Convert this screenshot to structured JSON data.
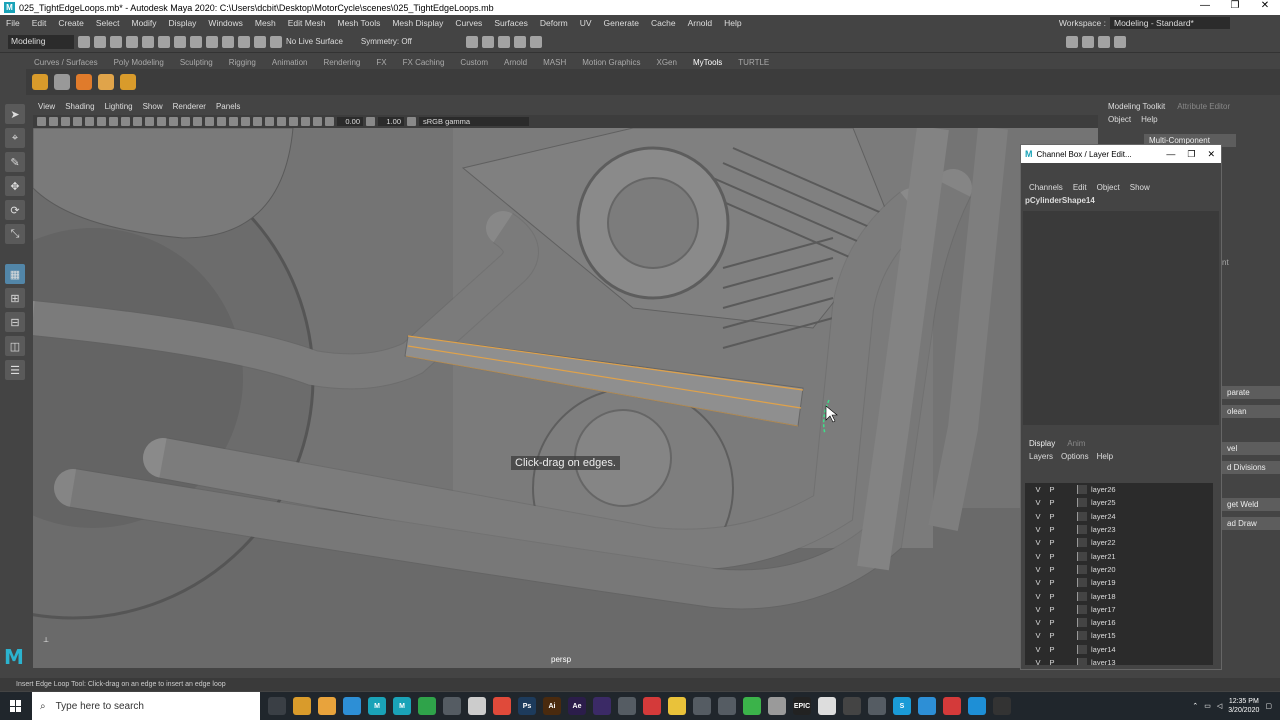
{
  "window": {
    "title": "025_TightEdgeLoops.mb* - Autodesk Maya 2020: C:\\Users\\dcbit\\Desktop\\MotorCycle\\scenes\\025_TightEdgeLoops.mb",
    "minimize": "—",
    "maximize": "❐",
    "close": "✕"
  },
  "menubar": {
    "items": [
      "File",
      "Edit",
      "Create",
      "Select",
      "Modify",
      "Display",
      "Windows",
      "Mesh",
      "Edit Mesh",
      "Mesh Tools",
      "Mesh Display",
      "Curves",
      "Surfaces",
      "Deform",
      "UV",
      "Generate",
      "Cache",
      "Arnold",
      "Help"
    ],
    "workspace_label": "Workspace :",
    "workspace_value": "Modeling - Standard*"
  },
  "statusline": {
    "mode": "Modeling",
    "live_surface": "No Live Surface",
    "symmetry": "Symmetry: Off"
  },
  "shelf": {
    "tabs": [
      "Curves / Surfaces",
      "Poly Modeling",
      "Sculpting",
      "Rigging",
      "Animation",
      "Rendering",
      "FX",
      "FX Caching",
      "Custom",
      "Arnold",
      "MASH",
      "Motion Graphics",
      "XGen",
      "MyTools",
      "TURTLE"
    ],
    "active_tab": "MyTools"
  },
  "panel": {
    "menus": [
      "View",
      "Shading",
      "Lighting",
      "Show",
      "Renderer",
      "Panels"
    ],
    "exposure": "0.00",
    "gamma": "1.00",
    "color_management": "sRGB gamma",
    "camera": "persp",
    "hint": "Click-drag on edges."
  },
  "modeling_toolkit": {
    "tab_active": "Modeling Toolkit",
    "tab_inactive": "Attribute Editor",
    "menus": [
      "Object",
      "Help"
    ],
    "multi_component": "Multi-Component",
    "buttons": [
      "parate",
      "olean",
      "vel",
      "d Divisions",
      "get Weld",
      "ad Draw"
    ],
    "side_text": "nt"
  },
  "channel_box": {
    "title": "Channel Box / Layer Edit...",
    "menus": [
      "Channels",
      "Edit",
      "Object",
      "Show"
    ],
    "shape": "pCylinderShape14",
    "layer_tabs": [
      "Display",
      "Anim"
    ],
    "layer_menus": [
      "Layers",
      "Options",
      "Help"
    ],
    "layers": [
      {
        "v": "V",
        "p": "P",
        "name": "layer26"
      },
      {
        "v": "V",
        "p": "P",
        "name": "layer25"
      },
      {
        "v": "V",
        "p": "P",
        "name": "layer24"
      },
      {
        "v": "V",
        "p": "P",
        "name": "layer23"
      },
      {
        "v": "V",
        "p": "P",
        "name": "layer22"
      },
      {
        "v": "V",
        "p": "P",
        "name": "layer21"
      },
      {
        "v": "V",
        "p": "P",
        "name": "layer20"
      },
      {
        "v": "V",
        "p": "P",
        "name": "layer19"
      },
      {
        "v": "V",
        "p": "P",
        "name": "layer18"
      },
      {
        "v": "V",
        "p": "P",
        "name": "layer17"
      },
      {
        "v": "V",
        "p": "P",
        "name": "layer16"
      },
      {
        "v": "V",
        "p": "P",
        "name": "layer15"
      },
      {
        "v": "V",
        "p": "P",
        "name": "layer14"
      },
      {
        "v": "V",
        "p": "P",
        "name": "layer13"
      }
    ]
  },
  "helpline": "Insert Edge Loop Tool: Click-drag on an edge to insert an edge loop",
  "taskbar": {
    "search_placeholder": "Type here to search",
    "apps": [
      {
        "label": "",
        "color": "#3a3f45"
      },
      {
        "label": "",
        "color": "#d99b2b"
      },
      {
        "label": "",
        "color": "#e8a33c"
      },
      {
        "label": "",
        "color": "#2d8fd6"
      },
      {
        "label": "M",
        "color": "#1aa3b8"
      },
      {
        "label": "M",
        "color": "#1aa3b8"
      },
      {
        "label": "",
        "color": "#2fa34a"
      },
      {
        "label": "",
        "color": "#555c63"
      },
      {
        "label": "",
        "color": "#cccccc"
      },
      {
        "label": "",
        "color": "#e04a3a"
      },
      {
        "label": "Ps",
        "color": "#1d3b5c"
      },
      {
        "label": "Ai",
        "color": "#4a2a0e"
      },
      {
        "label": "Ae",
        "color": "#2b1d4a"
      },
      {
        "label": "",
        "color": "#3b2a66"
      },
      {
        "label": "",
        "color": "#555c63"
      },
      {
        "label": "",
        "color": "#d43a3a"
      },
      {
        "label": "",
        "color": "#e9c23a"
      },
      {
        "label": "",
        "color": "#555c63"
      },
      {
        "label": "",
        "color": "#555c63"
      },
      {
        "label": "",
        "color": "#3bb34a"
      },
      {
        "label": "",
        "color": "#9a9a9a"
      },
      {
        "label": "EPIC",
        "color": "#222222"
      },
      {
        "label": "",
        "color": "#dddddd"
      },
      {
        "label": "",
        "color": "#444444"
      },
      {
        "label": "",
        "color": "#555c63"
      },
      {
        "label": "S",
        "color": "#1a9bd7"
      },
      {
        "label": "",
        "color": "#2d8fd6"
      },
      {
        "label": "",
        "color": "#d43a3a"
      },
      {
        "label": "",
        "color": "#1e8fd6"
      },
      {
        "label": "",
        "color": "#333333"
      }
    ],
    "time": "12:35 PM",
    "date": "3/20/2020"
  }
}
